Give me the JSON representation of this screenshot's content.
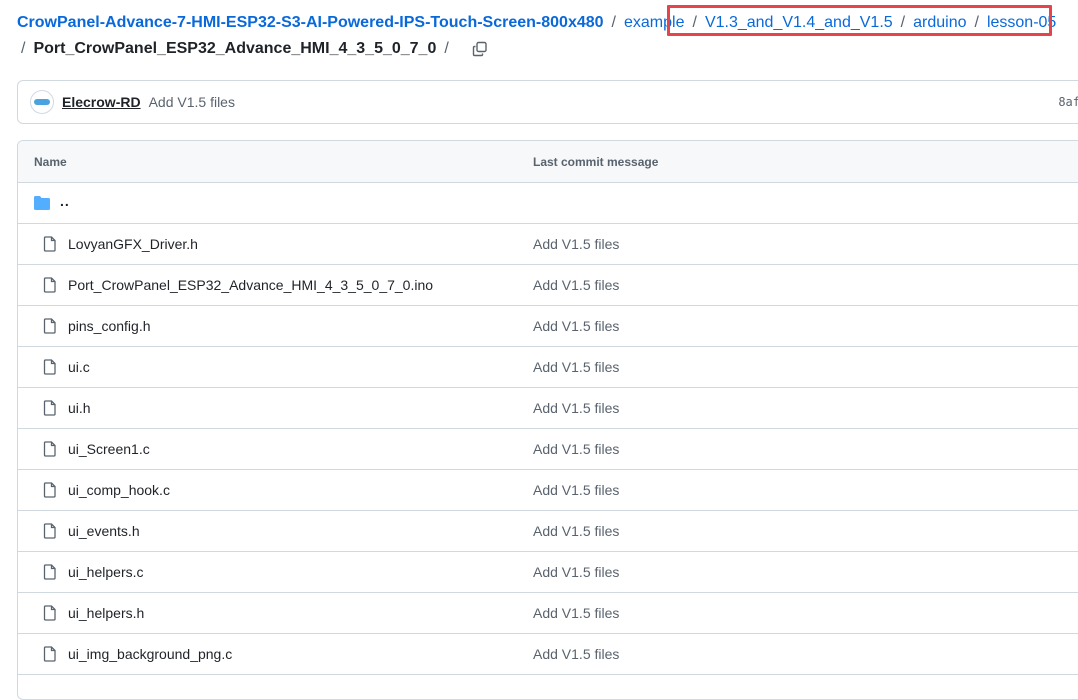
{
  "breadcrumb": {
    "repo": "CrowPanel-Advance-7-HMI-ESP32-S3-AI-Powered-IPS-Touch-Screen-800x480",
    "segments": [
      "example",
      "V1.3_and_V1.4_and_V1.5",
      "arduino",
      "lesson-05"
    ],
    "current": "Port_CrowPanel_ESP32_Advance_HMI_4_3_5_0_7_0",
    "separator": "/"
  },
  "commit": {
    "author": "Elecrow-RD",
    "message": "Add V1.5 files",
    "hash": "8af"
  },
  "table": {
    "headers": {
      "name": "Name",
      "last_commit": "Last commit message"
    },
    "parent": "..",
    "files": [
      {
        "name": "LovyanGFX_Driver.h",
        "message": "Add V1.5 files"
      },
      {
        "name": "Port_CrowPanel_ESP32_Advance_HMI_4_3_5_0_7_0.ino",
        "message": "Add V1.5 files"
      },
      {
        "name": "pins_config.h",
        "message": "Add V1.5 files"
      },
      {
        "name": "ui.c",
        "message": "Add V1.5 files"
      },
      {
        "name": "ui.h",
        "message": "Add V1.5 files"
      },
      {
        "name": "ui_Screen1.c",
        "message": "Add V1.5 files"
      },
      {
        "name": "ui_comp_hook.c",
        "message": "Add V1.5 files"
      },
      {
        "name": "ui_events.h",
        "message": "Add V1.5 files"
      },
      {
        "name": "ui_helpers.c",
        "message": "Add V1.5 files"
      },
      {
        "name": "ui_helpers.h",
        "message": "Add V1.5 files"
      },
      {
        "name": "ui_img_background_png.c",
        "message": "Add V1.5 files"
      }
    ]
  },
  "colors": {
    "link": "#0969da",
    "highlight": "#e5454a",
    "folder": "#54aeff"
  },
  "icons": {
    "file": "file-icon",
    "folder": "folder-icon",
    "copy": "copy-icon"
  }
}
